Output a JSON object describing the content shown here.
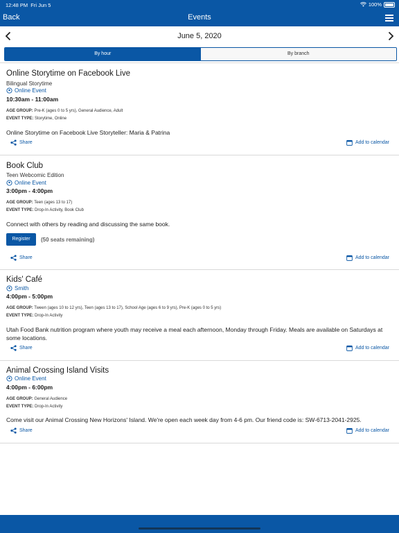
{
  "status": {
    "time": "12:48 PM",
    "date": "Fri Jun 5",
    "battery": "100%"
  },
  "nav": {
    "back_label": "Back",
    "title": "Events"
  },
  "date_nav": {
    "date": "June 5, 2020"
  },
  "tabs": [
    {
      "label": "By hour",
      "active": true
    },
    {
      "label": "By branch",
      "active": false
    }
  ],
  "labels": {
    "age_group": "AGE GROUP:",
    "event_type": "EVENT TYPE:",
    "share": "Share",
    "add_to_calendar": "Add to calendar"
  },
  "events": [
    {
      "title": "Online Storytime on Facebook Live",
      "subtitle": "Bilingual Storytime",
      "location": "Online Event",
      "time": "10:30am - 11:00am",
      "age_group": "Pre-K (ages 0 to 5 yrs), General Audience, Adult",
      "event_type": "Storytime, Online",
      "description": "Online Storytime on Facebook Live Storyteller: Maria & Patrina"
    },
    {
      "title": "Book Club",
      "subtitle": "Teen Webcomic Edition",
      "location": "Online Event",
      "time": "3:00pm - 4:00pm",
      "age_group": "Teen (ages 13 to 17)",
      "event_type": "Drop-In Activity, Book Club",
      "description": "Connect with others by reading and discussing the same book.",
      "register_label": "Register",
      "seats": "(50 seats remaining)"
    },
    {
      "title": "Kids' Café",
      "location": "Smith",
      "time": "4:00pm - 5:00pm",
      "age_group": "Tween (ages 10 to 12 yrs), Teen (ages 13 to 17), School Age (ages 6 to 9 yrs), Pre-K (ages 0 to 5 yrs)",
      "event_type": "Drop-In Activity",
      "description": "Utah Food Bank nutrition program where youth may receive a meal each afternoon, Monday through Friday. Meals are available on Saturdays at some locations."
    },
    {
      "title": "Animal Crossing Island Visits",
      "location": "Online Event",
      "time": "4:00pm - 6:00pm",
      "age_group": "General Audience",
      "event_type": "Drop-In Activity",
      "description": "Come visit our Animal Crossing New Horizons' Island. We're open each week day from 4-6 pm. Our friend code is: SW-6713-2041-2925."
    }
  ],
  "colors": {
    "brand": "#0a57a5",
    "divider": "#d9d9d9"
  }
}
